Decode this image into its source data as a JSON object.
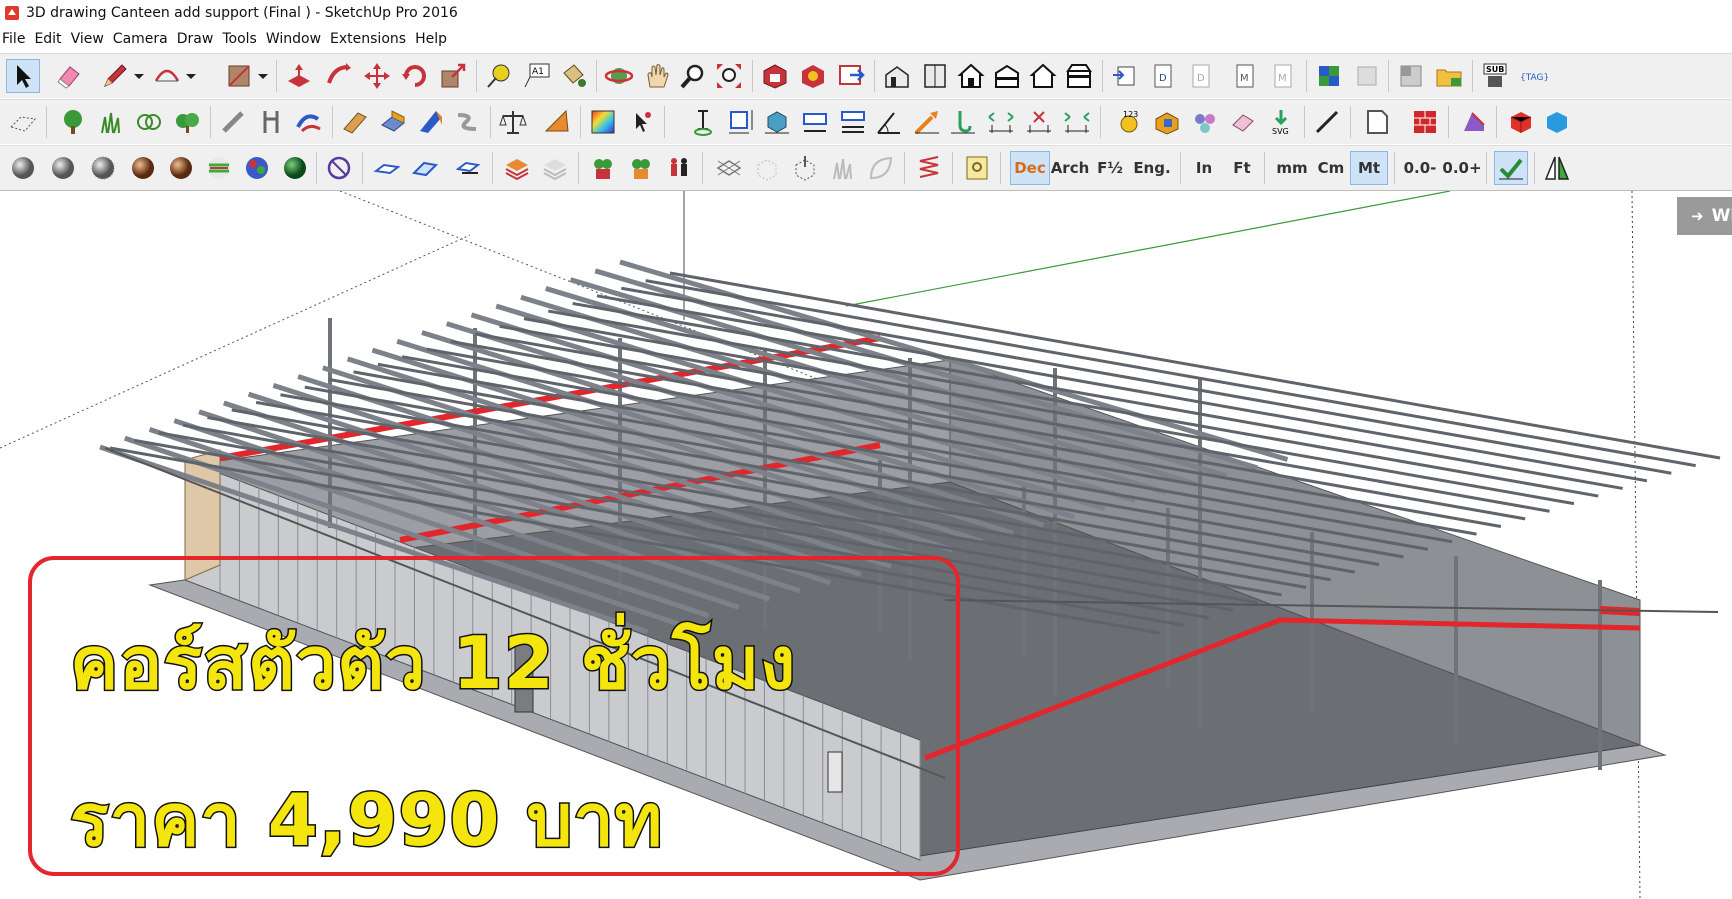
{
  "window": {
    "title": "3D drawing Canteen add support (Final ) - SketchUp Pro 2016"
  },
  "menu": [
    "File",
    "Edit",
    "View",
    "Camera",
    "Draw",
    "Tools",
    "Window",
    "Extensions",
    "Help"
  ],
  "units_toolbar": {
    "dec": "Dec",
    "arch": "Arch",
    "fraction": "F½",
    "eng": "Eng.",
    "inch": "In",
    "feet": "Ft",
    "mm": "mm",
    "cm": "Cm",
    "mt": "Mt",
    "precision_minus": "0.0-",
    "precision_plus": "0.0+"
  },
  "side_tab": {
    "label": "Wi"
  },
  "promo": {
    "line1": "คอร์สตัวตัว 12 ชั่วโมง",
    "line2": "ราคา 4,990 บาท"
  },
  "colors": {
    "accent_red": "#e3262b",
    "promo_yellow": "#f4e60c",
    "steel": "#8a8f96",
    "floor": "#6b6e73",
    "wall": "#c9cbcf"
  }
}
